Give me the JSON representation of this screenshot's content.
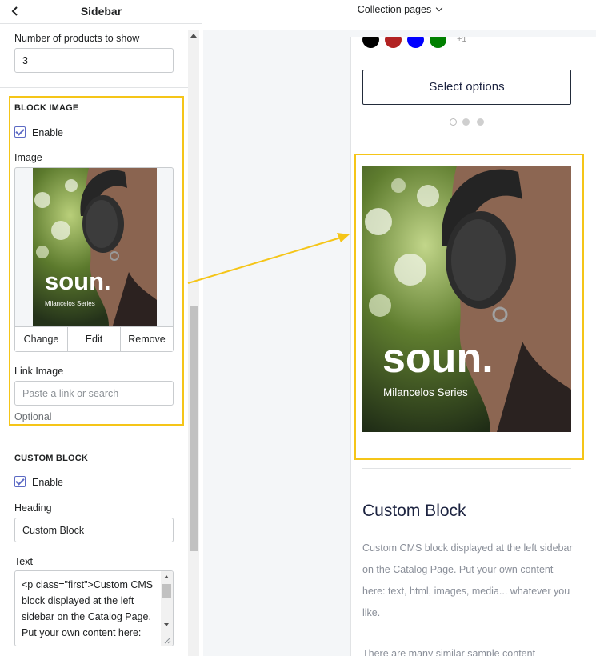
{
  "sidebar": {
    "title": "Sidebar",
    "products_label": "Number of products to show",
    "products_value": "3",
    "block_image": {
      "title": "BLOCK IMAGE",
      "enable_label": "Enable",
      "image_label": "Image",
      "thumb_brand": "soun.",
      "thumb_series": "Milancelos Series",
      "actions": [
        "Change",
        "Edit",
        "Remove"
      ],
      "link_label": "Link Image",
      "link_placeholder": "Paste a link or search",
      "optional_label": "Optional"
    },
    "custom_block": {
      "title": "CUSTOM BLOCK",
      "enable_label": "Enable",
      "heading_label": "Heading",
      "heading_value": "Custom Block",
      "text_label": "Text",
      "text_value": "<p class=\"first\">Custom CMS block displayed at the left sidebar on the Catalog Page. Put your own content here:"
    }
  },
  "preview": {
    "page_selector": "Collection pages",
    "swatches": [
      "#000000",
      "#b22222",
      "#0000ff",
      "#008000"
    ],
    "swatch_more": "+1",
    "select_button": "Select options",
    "carousel_active_index": 0,
    "hero_brand": "soun.",
    "hero_series": "Milancelos Series",
    "custom_heading": "Custom Block",
    "custom_text": "Custom CMS block displayed at the left sidebar on the Catalog Page. Put your own content here: text, html, images, media... whatever you like.",
    "custom_text_2": "There are many similar sample content"
  },
  "colors": {
    "highlight": "#f5c518",
    "accent": "#5c6ac4",
    "navy": "#1c2340"
  }
}
